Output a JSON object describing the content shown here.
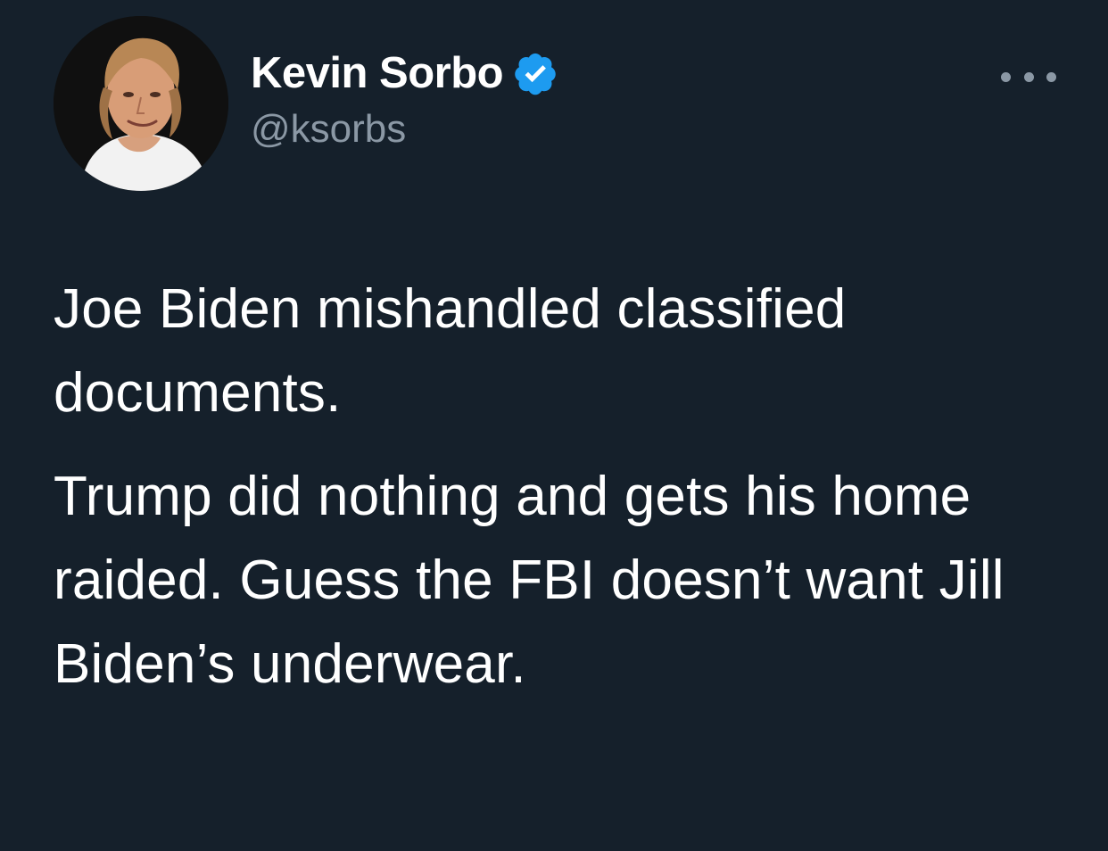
{
  "author": {
    "display_name": "Kevin Sorbo",
    "handle": "@ksorbs",
    "verified": true,
    "verified_icon": "verified-badge-icon",
    "verified_color": "#1d9bf0",
    "avatar_icon": "profile-photo"
  },
  "menu": {
    "icon": "more-options-icon"
  },
  "tweet": {
    "paragraphs": [
      "Joe Biden mishandled classified documents.",
      "Trump did nothing and gets his home raided. Guess the FBI doesn’t want Jill Biden’s underwear."
    ]
  },
  "colors": {
    "background": "#15202b",
    "primary_text": "#ffffff",
    "secondary_text": "#8b98a5",
    "accent": "#1d9bf0"
  }
}
